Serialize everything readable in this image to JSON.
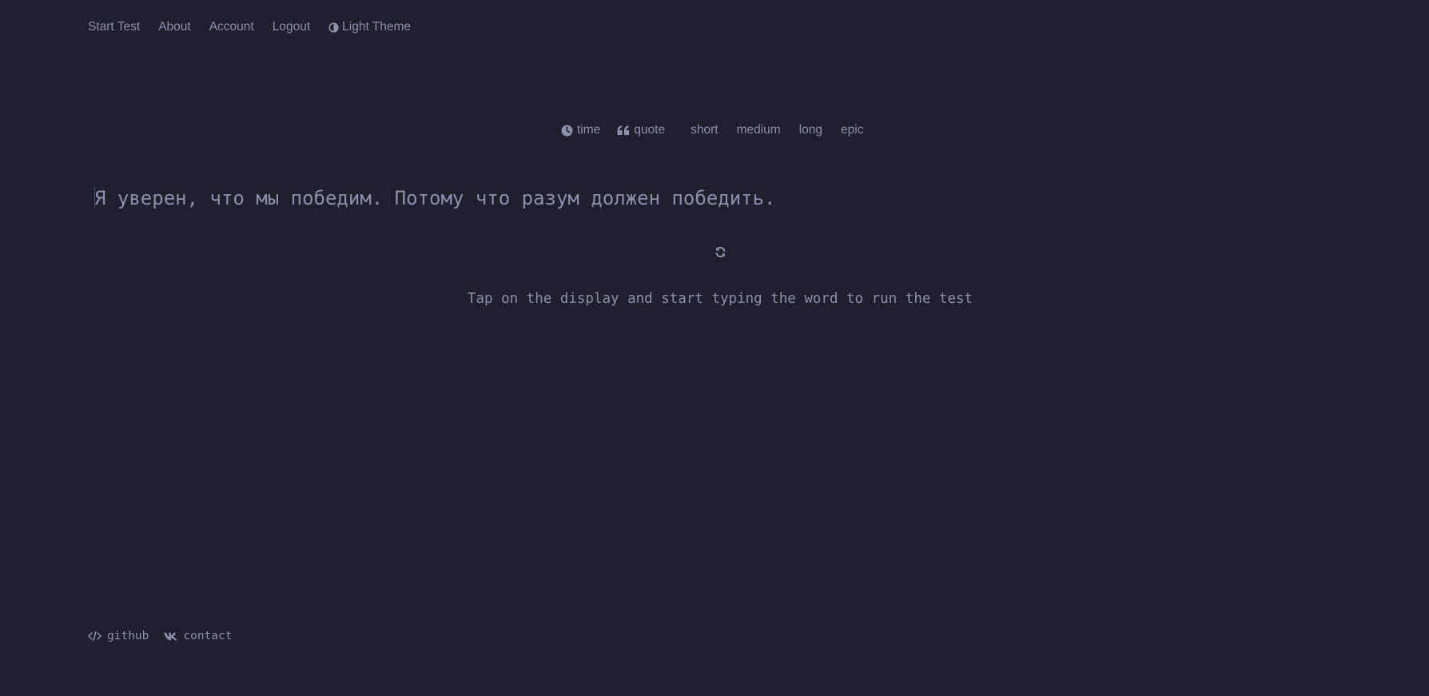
{
  "nav": {
    "start_test": "Start Test",
    "about": "About",
    "account": "Account",
    "logout": "Logout",
    "theme": "Light Theme"
  },
  "modes": {
    "time": "time",
    "quote": "quote",
    "lengths": [
      "short",
      "medium",
      "long",
      "epic"
    ]
  },
  "quote": {
    "text": "Я уверен, что мы победим. Потому что разум должен победить."
  },
  "hint": "Tap on the display and start typing the word to run the test",
  "footer": {
    "github": "github",
    "contact": "contact"
  },
  "icons": {
    "theme": "half-circle-icon",
    "time": "clock-icon",
    "quote": "quote-icon",
    "restart": "refresh-icon",
    "github": "code-icon",
    "contact": "vk-icon"
  },
  "colors": {
    "background": "#1f1f2e",
    "text": "#8c8fa8",
    "caret": "#4a4d66"
  }
}
